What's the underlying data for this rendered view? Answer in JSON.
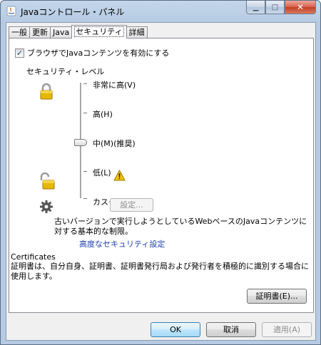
{
  "window": {
    "title": "Javaコントロール・パネル"
  },
  "tabs": [
    {
      "label": "一般"
    },
    {
      "label": "更新"
    },
    {
      "label": "Java"
    },
    {
      "label": "セキュリティ",
      "active": true
    },
    {
      "label": "詳細"
    }
  ],
  "security": {
    "enable_checkbox": {
      "label": "ブラウザでJavaコンテンツを有効にする",
      "checked": true
    },
    "level_heading": "セキュリティ・レベル",
    "levels": [
      {
        "label": "非常に高(V)"
      },
      {
        "label": "高(H)"
      },
      {
        "label": "中(M)(推奨)"
      },
      {
        "label": "低(L)"
      },
      {
        "label": "カスタ"
      }
    ],
    "selected_level": "中(M)(推奨)",
    "settings_button": "設定...",
    "description": "古いバージョンで実行しようとしているWebベースのJavaコンテンツに対する基本的な制限。",
    "advanced_link": "高度なセキュリティ設定"
  },
  "certificates": {
    "title": "Certificates",
    "description": "証明書は、自分自身、証明書、証明書発行局および発行者を積極的に識別する場合に使用します。",
    "button": "証明書(E)..."
  },
  "footer": {
    "ok": "OK",
    "cancel": "取消",
    "apply": "適用(A)"
  },
  "colors": {
    "link": "#1f3fae",
    "lock": "#e6b800",
    "warning": "#f5c400"
  },
  "icons": [
    "java-icon",
    "lock-closed-icon",
    "lock-open-icon",
    "gear-icon",
    "warning-icon"
  ]
}
